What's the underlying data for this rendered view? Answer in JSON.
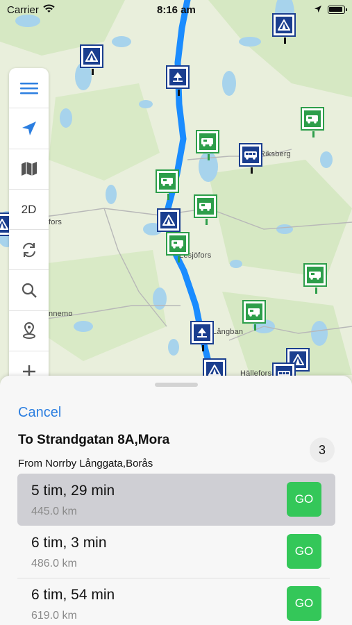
{
  "status_bar": {
    "carrier": "Carrier",
    "time": "8:16 am"
  },
  "toolbar": {
    "mode_label": "2D"
  },
  "map": {
    "labels": [
      "Riksberg",
      "fors",
      "Lesjöfors",
      "nnemo",
      "Långban",
      "Hällefors"
    ]
  },
  "sheet": {
    "cancel_label": "Cancel",
    "destination": "To Strandgatan 8A,Mora",
    "origin": "From Norrby Långgata,Borås",
    "route_count": "3",
    "routes": [
      {
        "time": "5 tim, 29 min",
        "distance": "445.0 km",
        "go_label": "GO",
        "selected": true
      },
      {
        "time": "6 tim, 3 min",
        "distance": "486.0 km",
        "go_label": "GO",
        "selected": false
      },
      {
        "time": "6 tim, 54 min",
        "distance": "619.0 km",
        "go_label": "GO",
        "selected": false
      }
    ]
  },
  "colors": {
    "accent": "#2b7ee0",
    "go": "#34c759",
    "route_line": "#1a8cff",
    "marker_blue": "#1a3e8f",
    "marker_green": "#2d9e4a"
  }
}
